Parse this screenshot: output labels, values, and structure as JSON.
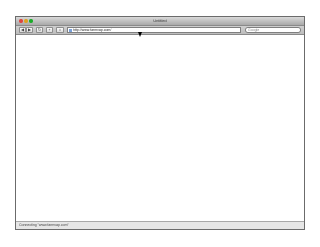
{
  "window": {
    "title": "Untitled"
  },
  "toolbar": {
    "back_glyph": "◀",
    "forward_glyph": "▶",
    "reload_glyph": "↻",
    "add_glyph": "+",
    "home_glyph": "⌂"
  },
  "address_bar": {
    "value": "http://www.farmvap.com/"
  },
  "search": {
    "placeholder": "Google"
  },
  "status_bar": {
    "text": "Connecting \"www.farmvap.com\""
  },
  "icons": [
    "close-icon",
    "minimize-icon",
    "zoom-icon",
    "back-icon",
    "forward-icon",
    "reload-icon",
    "add-bookmark-icon",
    "home-icon",
    "favicon-icon",
    "mouse-cursor-icon"
  ]
}
